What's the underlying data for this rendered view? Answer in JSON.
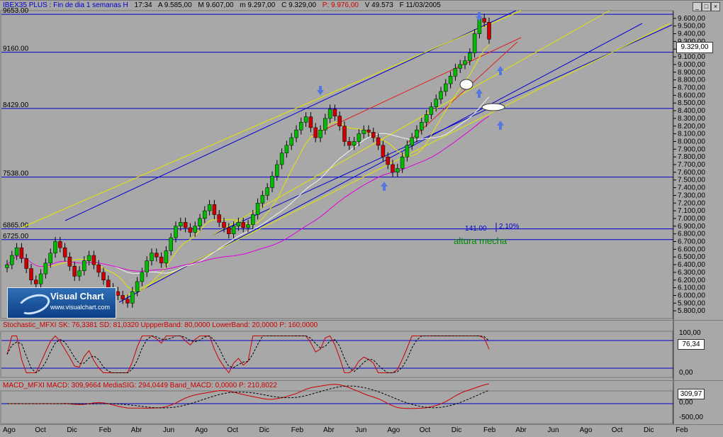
{
  "header": {
    "symbol": "IBEX35 PLUS : Fin de dia 1 semanas H",
    "time": "17:34",
    "open": "A 9.585,00",
    "high": "M 9.607,00",
    "low": "m 9.297,00",
    "close": "C 9.329,00",
    "pref": "P: 9.976,00",
    "vol": "V 49.573",
    "date": "F 11/03/2005"
  },
  "colors": {
    "bg": "#a8a8a8",
    "up": "#00bb00",
    "down": "#cc0000",
    "blue": "#0000cc",
    "yellow": "#e6e600",
    "red": "#dd2222",
    "magenta": "#dd00dd",
    "white": "#f2f2f2",
    "label_green": "#008800"
  },
  "levels": [
    {
      "label": "9653.00",
      "value": 9653
    },
    {
      "label": "9160.00",
      "value": 9160
    },
    {
      "label": "8429.00",
      "value": 8429
    },
    {
      "label": "7538.00",
      "value": 7538
    },
    {
      "label": "6865.00",
      "value": 6865
    },
    {
      "label": "6725.00",
      "value": 6725
    }
  ],
  "price_axis": [
    "9.600,00",
    "9.500,00",
    "9.400,00",
    "9.300,00",
    "9.200,00",
    "9.100,00",
    "9.000,00",
    "8.900,00",
    "8.800,00",
    "8.700,00",
    "8.600,00",
    "8.500,00",
    "8.400,00",
    "8.300,00",
    "8.200,00",
    "8.100,00",
    "8.000,00",
    "7.900,00",
    "7.800,00",
    "7.700,00",
    "7.600,00",
    "7.500,00",
    "7.400,00",
    "7.300,00",
    "7.200,00",
    "7.100,00",
    "7.000,00",
    "6.900,00",
    "6.800,00",
    "6.700,00",
    "6.600,00",
    "6.500,00",
    "6.400,00",
    "6.300,00",
    "6.200,00",
    "6.100,00",
    "6.000,00",
    "5.900,00",
    "5.800,00"
  ],
  "last_price_tag": "9.329,00",
  "annotations": {
    "distance": "141.00",
    "pct": "2.10%",
    "wick": "altura mecha"
  },
  "logo": {
    "title": "Visual Chart",
    "url": "www.visualchart.com"
  },
  "stochastic": {
    "label": "Stochastic_MFXI SK: 76,3381 SD: 81,0320 UppperBand: 80,0000 LowerBand: 20,0000 P: 160,0000",
    "axis": [
      "100,00",
      "0,00"
    ],
    "tag": "76,34"
  },
  "macd": {
    "label": "MACD_MFXI MACD: 309,9664 MediaSIG: 294,0449 Band_MACD: 0,0000 P: 210,8022",
    "axis": [
      "0,00",
      "-500,00"
    ],
    "tag": "309,97"
  },
  "months": [
    "Ago",
    "Oct",
    "Dic",
    "Feb",
    "Abr",
    "Jun",
    "Ago",
    "Oct",
    "Dic",
    "Feb",
    "Abr",
    "Jun",
    "Ago",
    "Oct",
    "Dic",
    "Feb",
    "Abr",
    "Jun",
    "Ago",
    "Oct",
    "Dic",
    "Feb"
  ],
  "chart_data": {
    "type": "candlestick",
    "y_range": [
      5700,
      9700
    ],
    "closes": [
      6400,
      6520,
      6620,
      6480,
      6350,
      6200,
      6150,
      6280,
      6420,
      6550,
      6700,
      6620,
      6500,
      6380,
      6250,
      6320,
      6450,
      6520,
      6400,
      6300,
      6200,
      6100,
      6050,
      6000,
      5950,
      5900,
      6050,
      6180,
      6300,
      6450,
      6550,
      6500,
      6420,
      6580,
      6750,
      6900,
      6950,
      6880,
      6820,
      6900,
      7000,
      7100,
      7180,
      7050,
      6950,
      6880,
      6800,
      6900,
      6950,
      6880,
      6920,
      7050,
      7200,
      7300,
      7400,
      7550,
      7700,
      7850,
      7950,
      8050,
      8150,
      8250,
      8320,
      8180,
      8050,
      8150,
      8300,
      8420,
      8330,
      8200,
      8000,
      7950,
      8000,
      8100,
      8150,
      8120,
      8050,
      7950,
      7800,
      7700,
      7600,
      7650,
      7800,
      7950,
      8050,
      8150,
      8250,
      8350,
      8450,
      8550,
      8650,
      8750,
      8850,
      8950,
      9000,
      9050,
      9150,
      9400,
      9600,
      9550,
      9329
    ]
  }
}
